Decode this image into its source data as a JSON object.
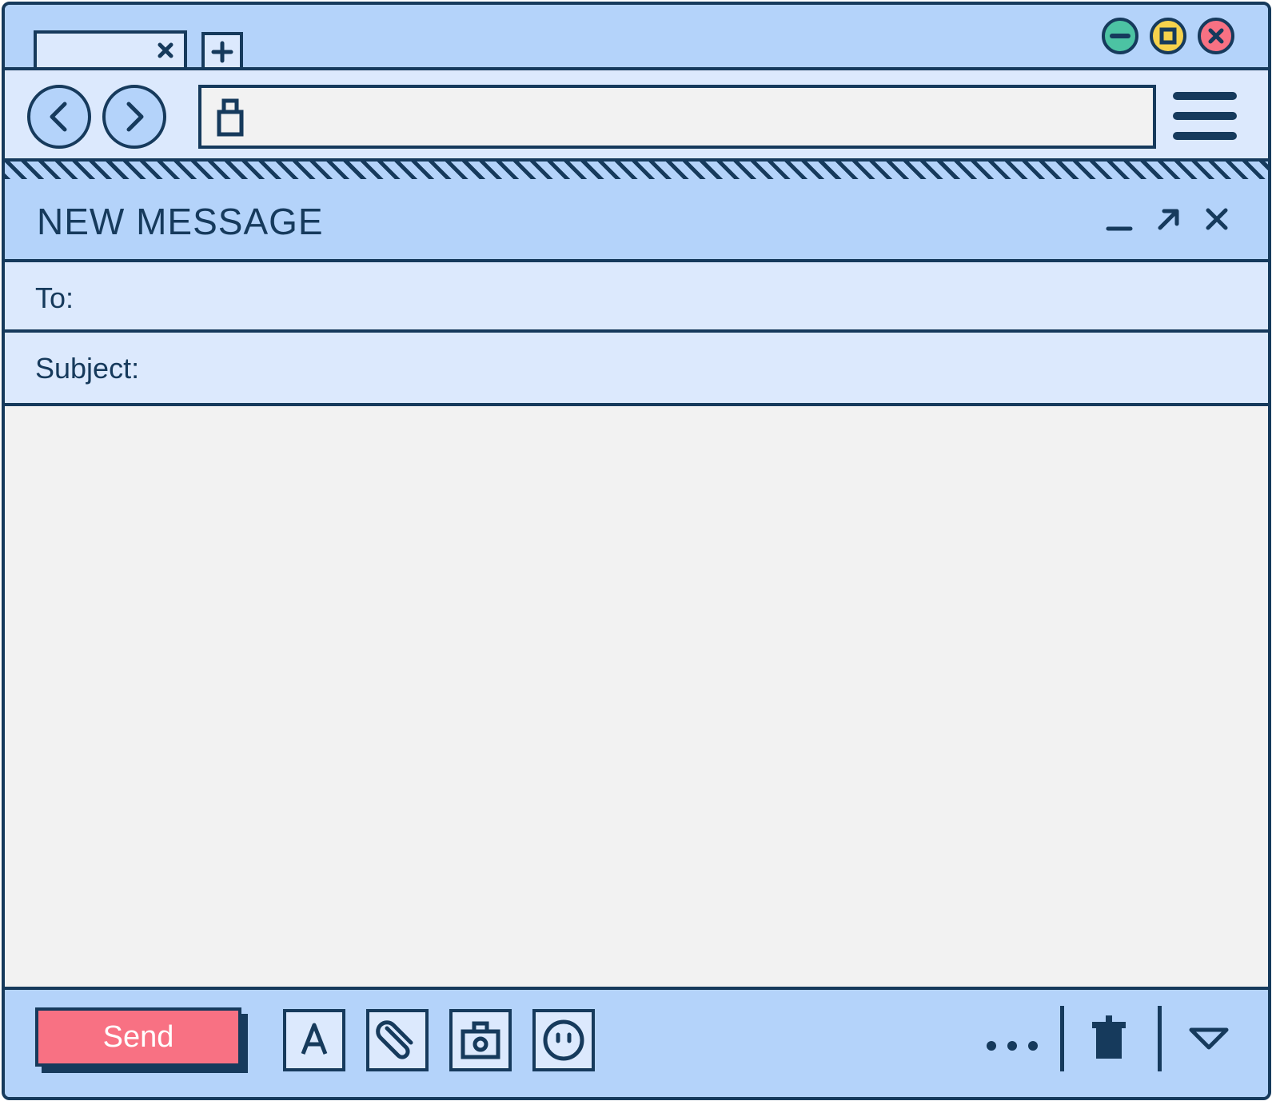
{
  "colors": {
    "outline": "#163a5c",
    "chrome_blue": "#b4d3fa",
    "light_blue": "#dce9fd",
    "canvas": "#f2f2f2",
    "send_button": "#f87183",
    "minimize_button": "#4cc3a3",
    "maximize_button": "#f6d24c",
    "close_button": "#f87183"
  },
  "browser": {
    "tab": {
      "title": "",
      "close_icon": "close-icon"
    },
    "new_tab_icon": "plus-icon",
    "window_controls": [
      "minimize-icon",
      "maximize-icon",
      "close-icon"
    ],
    "nav": {
      "back_icon": "chevron-left-icon",
      "forward_icon": "chevron-right-icon"
    },
    "address_bar": {
      "value": "",
      "lock_icon": "lock-icon"
    },
    "menu_icon": "hamburger-menu-icon"
  },
  "message": {
    "title": "NEW MESSAGE",
    "header_icons": [
      "minimize-icon",
      "pop-out-arrow-icon",
      "close-icon"
    ],
    "to_label": "To:",
    "to_value": "",
    "subject_label": "Subject:",
    "subject_value": "",
    "body_value": ""
  },
  "footer": {
    "send_label": "Send",
    "tools": [
      "text-format-icon",
      "paperclip-icon",
      "camera-icon",
      "emoji-icon"
    ],
    "right_tools": [
      "more-options-icon",
      "trash-icon",
      "dropdown-triangle-icon"
    ]
  }
}
